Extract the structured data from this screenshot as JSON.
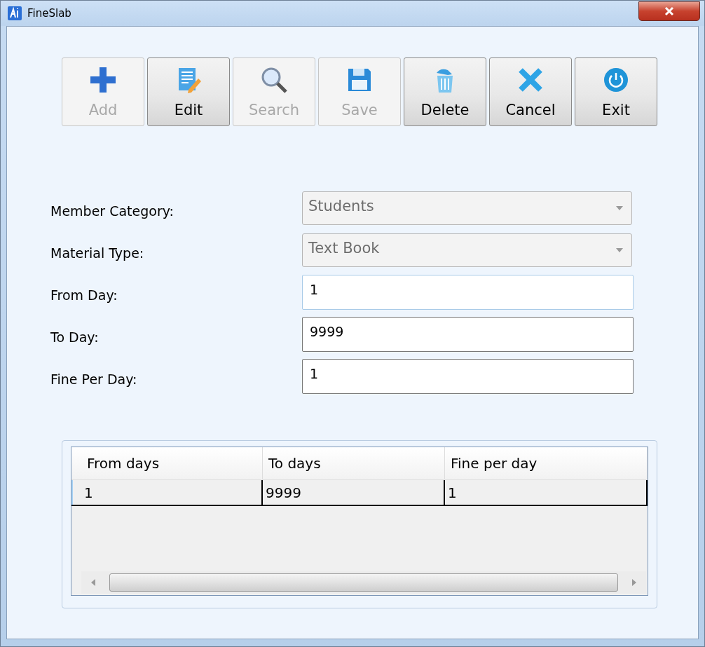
{
  "window": {
    "title": "FineSlab"
  },
  "toolbar": [
    {
      "label": "Add",
      "disabled": true
    },
    {
      "label": "Edit",
      "disabled": false
    },
    {
      "label": "Search",
      "disabled": true
    },
    {
      "label": "Save",
      "disabled": true
    },
    {
      "label": "Delete",
      "disabled": false
    },
    {
      "label": "Cancel",
      "disabled": false
    },
    {
      "label": "Exit",
      "disabled": false
    }
  ],
  "form": [
    {
      "kind": "dropdown",
      "label": "Member Category:",
      "value": "Students",
      "disabled": true
    },
    {
      "kind": "dropdown",
      "label": "Material Type:",
      "value": "Text Book",
      "disabled": true
    },
    {
      "kind": "text",
      "label": "From Day:",
      "value": "1",
      "focused": true
    },
    {
      "kind": "text",
      "label": "To Day:",
      "value": "9999",
      "focused": false
    },
    {
      "kind": "text",
      "label": "Fine Per Day:",
      "value": "1",
      "focused": false
    }
  ],
  "table": {
    "columns": [
      "From days",
      "To days",
      "Fine per day"
    ],
    "rows": [
      {
        "cells": [
          "1",
          "9999",
          "1"
        ],
        "selected": true
      }
    ]
  }
}
